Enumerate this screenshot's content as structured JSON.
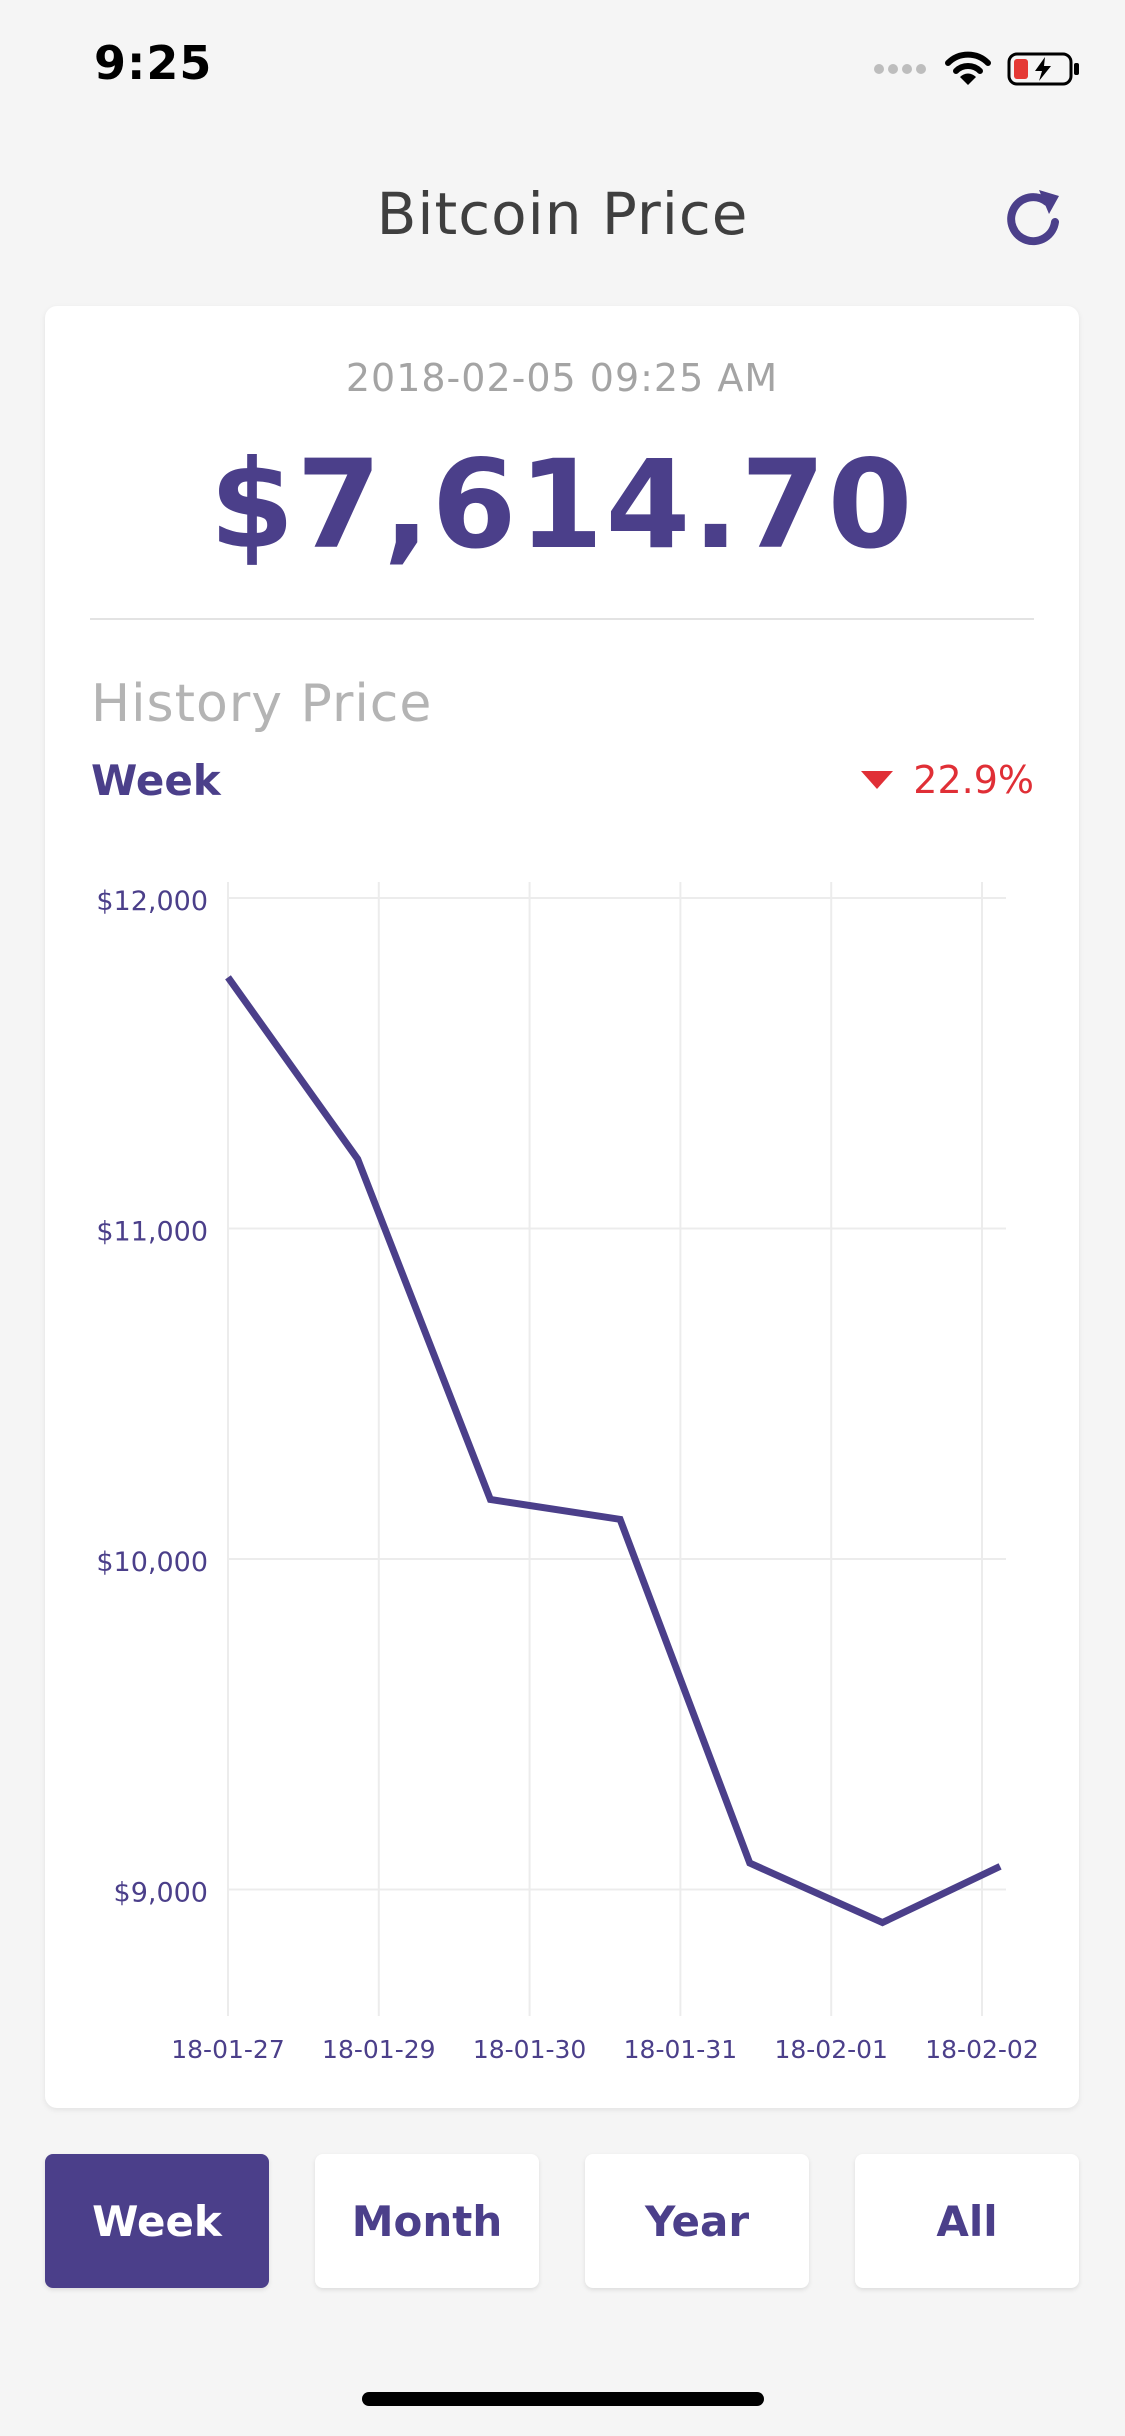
{
  "status_bar": {
    "time": "9:25"
  },
  "header": {
    "title": "Bitcoin Price",
    "refresh_icon": "refresh-icon"
  },
  "current": {
    "timestamp": "2018-02-05 09:25 AM",
    "price": "$7,614.70"
  },
  "history": {
    "label": "History Price",
    "period": "Week",
    "change": "22.9%",
    "change_direction": "down",
    "change_color": "#e02f36"
  },
  "chart_data": {
    "type": "line",
    "x_tick_labels": [
      "18-01-27",
      "18-01-29",
      "18-01-30",
      "18-01-31",
      "18-02-01",
      "18-02-02"
    ],
    "y_tick_labels": [
      "$12,000",
      "$11,000",
      "$10,000",
      "$9,000"
    ],
    "y_ticks": [
      12000,
      11000,
      10000,
      9000
    ],
    "ylim": [
      8650,
      12050
    ],
    "x_positions": [
      0,
      0.86,
      1.74,
      2.6,
      3.46,
      4.34,
      5.12
    ],
    "values": [
      11760,
      11210,
      10180,
      10120,
      9080,
      8900,
      9070
    ],
    "grid": true,
    "line_color": "#4b3f8a"
  },
  "tabs": [
    {
      "label": "Week",
      "active": true
    },
    {
      "label": "Month",
      "active": false
    },
    {
      "label": "Year",
      "active": false
    },
    {
      "label": "All",
      "active": false
    }
  ],
  "colors": {
    "accent": "#4b3f8a",
    "negative": "#e02f36",
    "background": "#f5f5f5"
  }
}
